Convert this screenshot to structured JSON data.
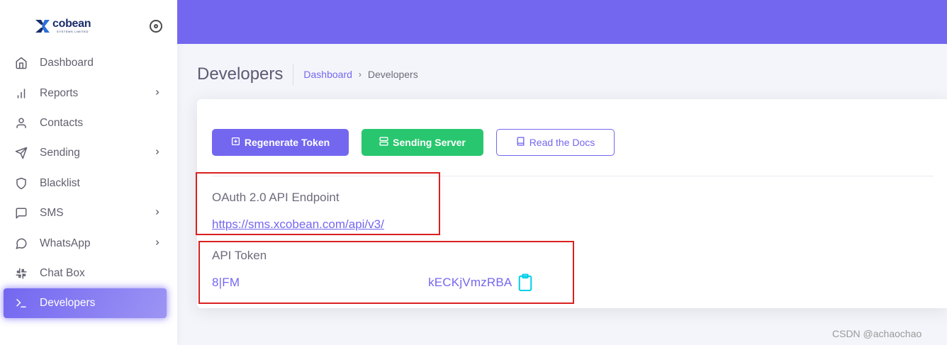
{
  "brand": {
    "name": "cobean",
    "subtitle": "SYSTEMS LIMITED",
    "logo_mark": "X",
    "color": "#1a2d6b"
  },
  "sidebar": {
    "items": [
      {
        "label": "Dashboard",
        "icon": "home-icon",
        "has_submenu": false
      },
      {
        "label": "Reports",
        "icon": "bar-chart-icon",
        "has_submenu": true
      },
      {
        "label": "Contacts",
        "icon": "user-icon",
        "has_submenu": false
      },
      {
        "label": "Sending",
        "icon": "send-icon",
        "has_submenu": true
      },
      {
        "label": "Blacklist",
        "icon": "shield-icon",
        "has_submenu": false
      },
      {
        "label": "SMS",
        "icon": "message-square-icon",
        "has_submenu": true
      },
      {
        "label": "WhatsApp",
        "icon": "message-circle-icon",
        "has_submenu": true
      },
      {
        "label": "Chat Box",
        "icon": "slack-icon",
        "has_submenu": false
      },
      {
        "label": "Developers",
        "icon": "terminal-icon",
        "has_submenu": false,
        "active": true
      }
    ]
  },
  "header": {
    "title": "Developers",
    "breadcrumb": {
      "parent": "Dashboard",
      "separator": "›",
      "current": "Developers"
    }
  },
  "actions": {
    "regenerate": "Regenerate Token",
    "sending_server": "Sending Server",
    "read_docs": "Read the Docs"
  },
  "api": {
    "endpoint_label": "OAuth 2.0 API Endpoint",
    "endpoint_url": "https://sms.xcobean.com/api/v3/",
    "token_label": "API Token",
    "token_value": "8|FM                                                      kECKjVmzRBA"
  },
  "colors": {
    "primary": "#7367f0",
    "success": "#28c76f",
    "copy_icon": "#00cfe8",
    "annotation": "#d9201f"
  },
  "watermark": "CSDN @achaochao"
}
